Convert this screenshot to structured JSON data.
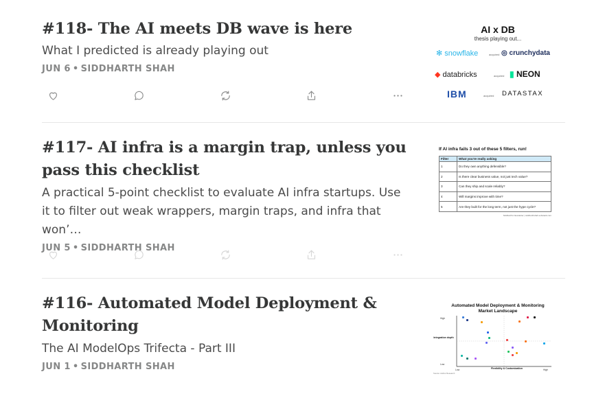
{
  "posts": [
    {
      "title": "#118- The AI meets DB wave is here",
      "subtitle": "What I predicted is already playing out",
      "date": "JUN 6",
      "separator": "•",
      "author": "SIDDHARTH SHAH",
      "thumbnail": {
        "title": "AI x DB",
        "subtitle": "thesis playing out...",
        "logos": [
          "snowflake",
          "crunchydata",
          "databricks",
          "NEON",
          "IBM",
          "DATASTAX"
        ],
        "acquired_label": "acquired"
      }
    },
    {
      "title": "#117- AI infra is a margin trap, unless you pass this checklist",
      "subtitle": "A practical 5-point checklist to evaluate AI infra startups. Use it to filter out weak wrappers, margin traps, and infra that won’…",
      "date": "JUN 5",
      "separator": "•",
      "author": "SIDDHARTH SHAH",
      "thumbnail": {
        "heading": "If AI infra fails 3 out of these 5 filters, run!",
        "col1": "Filter",
        "col2": "What you're really asking",
        "rows": [
          {
            "n": "1",
            "q": "Do they own anything defensible?"
          },
          {
            "n": "2",
            "q": "Is there clear business value, not just tech value?"
          },
          {
            "n": "3",
            "q": "Can they ship and scale reliably?"
          },
          {
            "n": "4",
            "q": "Will margins improve with time?"
          },
          {
            "n": "5",
            "q": "Are they built for the long term, not just the hype cycle?"
          }
        ],
        "footer": "Siddharth's Newsletter | siddharthshah.substack.com"
      }
    },
    {
      "title": "#116- Automated Model Deployment & Monitoring",
      "subtitle": "The AI ModelOps Trifecta - Part III",
      "date": "JUN 1",
      "separator": "•",
      "author": "SIDDHARTH SHAH",
      "thumbnail": {
        "title_line1": "Automated Model Deployment & Monitoring",
        "title_line2": "Market Landscape",
        "y_axis": "Integration depth",
        "x_axis": "Flexibility & Customization",
        "high": "High",
        "low": "Low",
        "source": "Source: Author Research"
      }
    }
  ],
  "actions": {
    "like": "heart-icon",
    "comment": "comment-icon",
    "restack": "restack-icon",
    "share": "share-icon",
    "more": "more-icon"
  },
  "colors": {
    "title": "#363737",
    "meta": "#868787",
    "icon": "#8a8b8b",
    "divider": "#e6e6e6"
  }
}
